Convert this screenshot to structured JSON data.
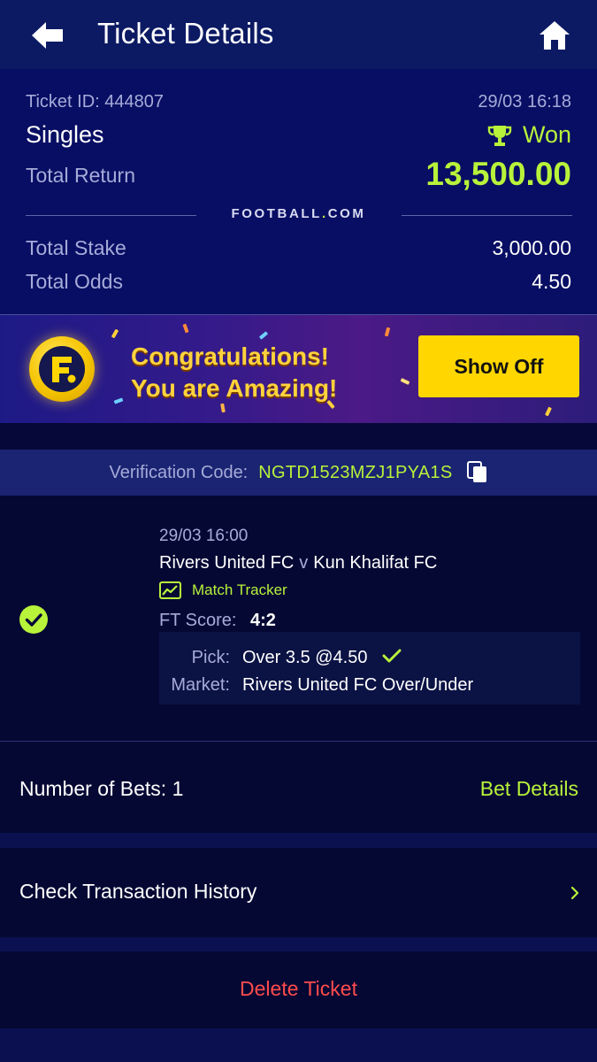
{
  "header": {
    "title": "Ticket Details",
    "back_icon": "arrow-left-icon",
    "home_icon": "home-icon"
  },
  "ticket": {
    "id_text": "Ticket ID: 444807",
    "datetime": "29/03 16:18",
    "bet_type": "Singles",
    "status": "Won",
    "status_icon": "trophy-icon",
    "return_label": "Total Return",
    "return_value": "13,500.00",
    "brand": {
      "pre": "FOOTBALL",
      "dot": ".",
      "post": "COM"
    },
    "stake_label": "Total Stake",
    "stake_value": "3,000.00",
    "odds_label": "Total Odds",
    "odds_value": "4.50"
  },
  "banner": {
    "logo_icon": "f-logo-icon",
    "line1": "Congratulations!",
    "line2": "You are Amazing!",
    "button": "Show Off"
  },
  "verification": {
    "label": "Verification Code:",
    "code": "NGTD1523MZJ1PYA1S",
    "copy_icon": "copy-icon"
  },
  "match": {
    "status_icon": "check-circle-icon",
    "datetime": "29/03 16:00",
    "home_team": "Rivers United FC",
    "vs": "v",
    "away_team": "Kun Khalifat FC",
    "tracker_label": "Match Tracker",
    "tracker_icon": "chart-line-icon",
    "ft_label": "FT Score:",
    "ft_score": "4:2",
    "pick_label": "Pick:",
    "pick_value": "Over 3.5 @4.50",
    "market_label": "Market:",
    "market_value": "Rivers United FC Over/Under"
  },
  "bets": {
    "count_text": "Number of Bets: 1",
    "details_link": "Bet Details"
  },
  "history": {
    "label": "Check Transaction History",
    "chevron_icon": "chevron-right-icon"
  },
  "delete": {
    "label": "Delete Ticket"
  },
  "colors": {
    "accent_green": "#b8f23a",
    "header_bg": "#0c1a63",
    "summary_bg": "#080e63",
    "page_bg": "#050833",
    "button_yellow": "#ffd600",
    "danger_red": "#ff4c4c"
  }
}
